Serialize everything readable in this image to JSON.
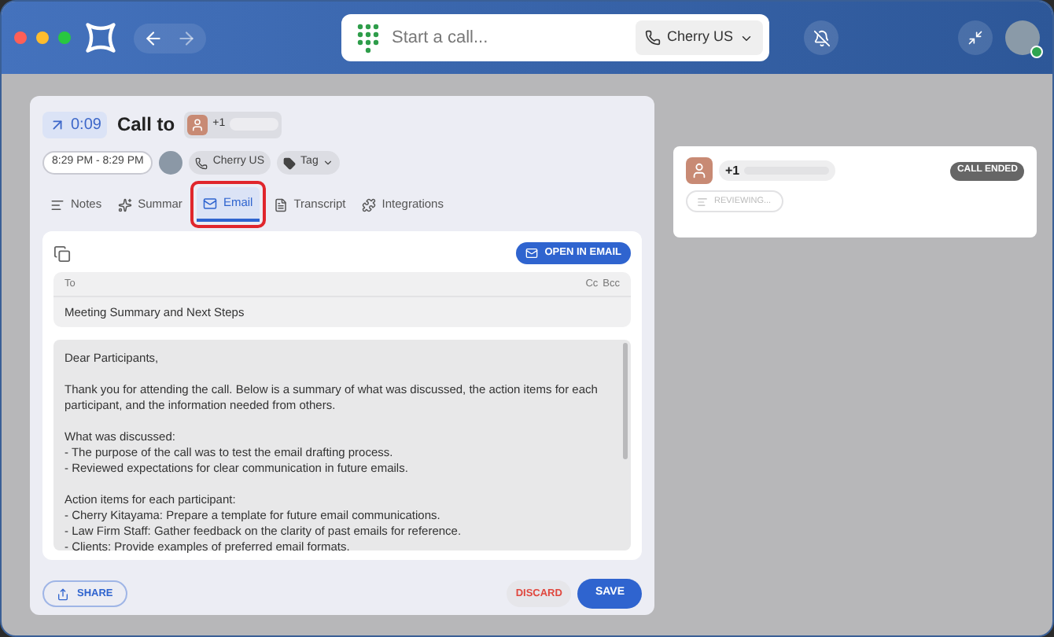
{
  "titlebar": {
    "search": {
      "placeholder": "Start a call..."
    },
    "line": "Cherry US"
  },
  "call": {
    "timer": "0:09",
    "title": "Call to",
    "number": "+1",
    "time_range": "8:29 PM - 8:29 PM",
    "line": "Cherry US",
    "tag": "Tag"
  },
  "tabs": [
    {
      "kind": "notes",
      "label": "Notes",
      "selected": false,
      "highlighted": false
    },
    {
      "kind": "summary",
      "label": "Summar",
      "selected": false,
      "highlighted": false
    },
    {
      "kind": "email",
      "label": "Email",
      "selected": true,
      "highlighted": true
    },
    {
      "kind": "transcript",
      "label": "Transcript",
      "selected": false,
      "highlighted": false
    },
    {
      "kind": "integrations",
      "label": "Integrations",
      "selected": false,
      "highlighted": false
    }
  ],
  "email": {
    "open_button": "OPEN IN EMAIL",
    "to": {
      "placeholder": "To"
    },
    "cc": "Cc",
    "bcc": "Bcc",
    "subject": "Meeting Summary and Next Steps",
    "body": [
      [
        "Dear Participants,"
      ],
      [
        "Thank you for attending the call. Below is a summary of what was discussed, the action items for each participant, and the information needed from others."
      ],
      [
        "What was discussed:",
        "- The purpose of the call was to test the email drafting process.",
        "- Reviewed expectations for clear communication in future emails."
      ],
      [
        "Action items for each participant:",
        "- Cherry Kitayama: Prepare a template for future email communications.",
        "- Law Firm Staff: Gather feedback on the clarity of past emails for reference.",
        "- Clients: Provide examples of preferred email formats."
      ]
    ]
  },
  "footer": {
    "share": "SHARE",
    "discard": "DISCARD",
    "save": "SAVE"
  },
  "popup": {
    "number": "+1",
    "status": "CALL ENDED",
    "reviewing": "REVIEWING..."
  }
}
